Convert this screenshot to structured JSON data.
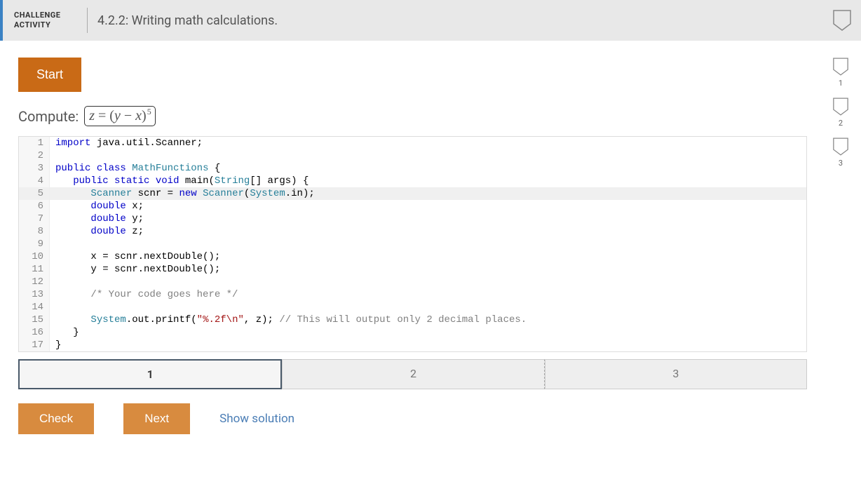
{
  "header": {
    "challenge_label_line1": "CHALLENGE",
    "challenge_label_line2": "ACTIVITY",
    "title": "4.2.2: Writing math calculations."
  },
  "side_progress": [
    "1",
    "2",
    "3"
  ],
  "start_label": "Start",
  "compute_label": "Compute:",
  "formula": {
    "lhs": "z",
    "eq": "=",
    "open": "(",
    "y": "y",
    "minus": "−",
    "x": "x",
    "close": ")",
    "exp": "5"
  },
  "code_lines": [
    {
      "n": 1,
      "html": "<span class='kw'>import</span> java.util.Scanner;"
    },
    {
      "n": 2,
      "html": ""
    },
    {
      "n": 3,
      "html": "<span class='kw'>public</span> <span class='kw'>class</span> <span class='cls'>MathFunctions</span> {"
    },
    {
      "n": 4,
      "html": "   <span class='kw'>public</span> <span class='kw'>static</span> <span class='kw'>void</span> main(<span class='cls'>String</span>[] args) {"
    },
    {
      "n": 5,
      "hl": true,
      "html": "      <span class='cls'>Scanner</span> <span>s</span>cnr = <span class='kw'>new</span> <span class='cls'>Scanner</span>(<span class='id2'>System</span>.in);"
    },
    {
      "n": 6,
      "html": "      <span class='kw'>double</span> x;"
    },
    {
      "n": 7,
      "html": "      <span class='kw'>double</span> y;"
    },
    {
      "n": 8,
      "html": "      <span class='kw'>double</span> z;"
    },
    {
      "n": 9,
      "html": ""
    },
    {
      "n": 10,
      "html": "      x = scnr.nextDouble();"
    },
    {
      "n": 11,
      "html": "      y = scnr.nextDouble();"
    },
    {
      "n": 12,
      "html": ""
    },
    {
      "n": 13,
      "html": "      <span class='com'>/* Your code goes here */</span>"
    },
    {
      "n": 14,
      "html": ""
    },
    {
      "n": 15,
      "html": "      <span class='id2'>System</span>.out.printf(<span class='str'>\"%.2f\\n\"</span>, z); <span class='com'>// This will output only 2 decimal places.</span>"
    },
    {
      "n": 16,
      "html": "   }"
    },
    {
      "n": 17,
      "html": "}"
    }
  ],
  "progress_tabs": [
    {
      "label": "1",
      "active": true
    },
    {
      "label": "2",
      "active": false
    },
    {
      "label": "3",
      "active": false
    }
  ],
  "actions": {
    "check": "Check",
    "next": "Next",
    "show_solution": "Show solution"
  }
}
